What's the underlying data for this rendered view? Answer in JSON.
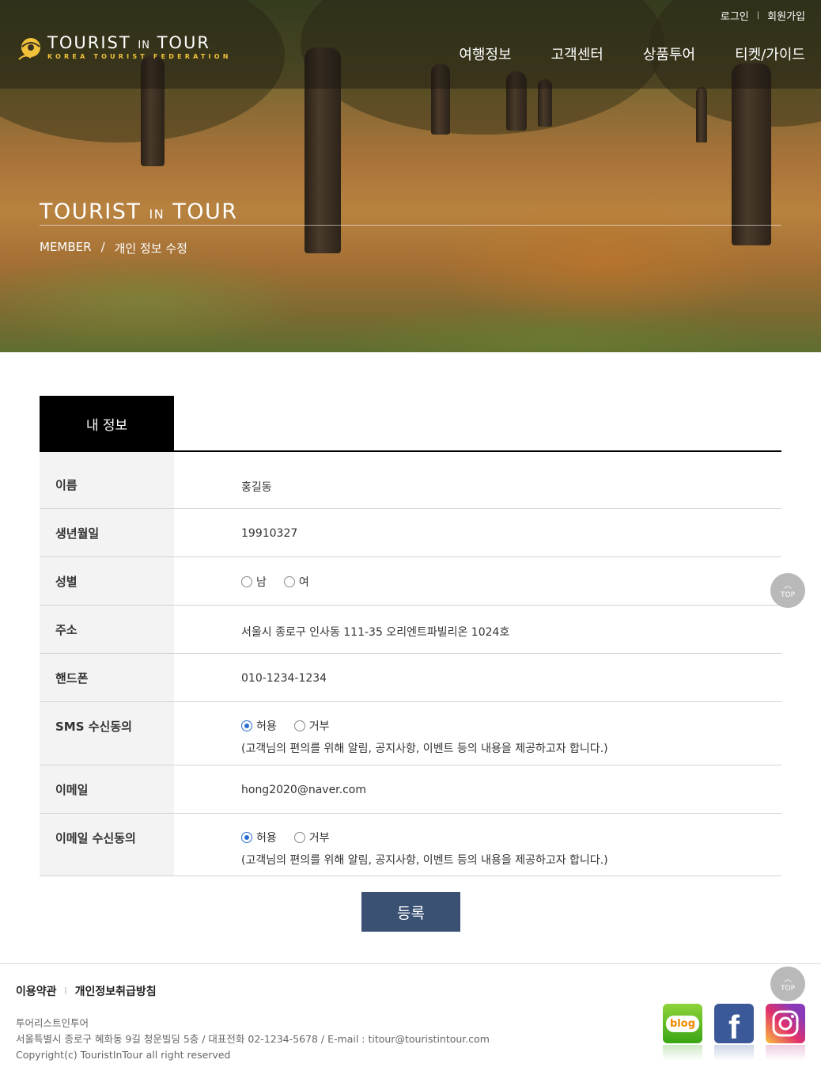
{
  "header": {
    "logo_title": "TOURIST",
    "logo_in": "IN",
    "logo_tour": "TOUR",
    "logo_sub": "KOREA TOURIST FEDERATION",
    "util": {
      "login": "로그인",
      "sep": "|",
      "join": "회원가입"
    },
    "nav": [
      "여행정보",
      "고객센터",
      "상품투어",
      "티켓/가이드"
    ]
  },
  "hero": {
    "title": "TOURIST",
    "title_in": "IN",
    "title_tour": "TOUR",
    "breadcrumb": {
      "root": "MEMBER",
      "sep": "/",
      "current": "개인 정보 수정"
    }
  },
  "tab": {
    "label": "내 정보"
  },
  "form": {
    "name": {
      "label": "이름",
      "value": "홍길동"
    },
    "birth": {
      "label": "생년월일",
      "value": "19910327"
    },
    "gender": {
      "label": "성별",
      "options": [
        "남",
        "여"
      ],
      "selected": null
    },
    "address": {
      "label": "주소",
      "value": "서울시 종로구 인사동 111-35 오리엔트파빌리온 1024호"
    },
    "phone": {
      "label": "핸드폰",
      "value": "010-1234-1234"
    },
    "sms": {
      "label": "SMS 수신동의",
      "options": [
        "허용",
        "거부"
      ],
      "selected": "허용",
      "note": "(고객님의 편의를 위해 알림, 공지사항, 이벤트 등의 내용을 제공하고자 합니다.)"
    },
    "email": {
      "label": "이메일",
      "value": "hong2020@naver.com"
    },
    "email_consent": {
      "label": "이메일 수신동의",
      "options": [
        "허용",
        "거부"
      ],
      "selected": "허용",
      "note": "(고객님의 편의를 위해 알림, 공지사항, 이벤트 등의 내용을 제공하고자 합니다.)"
    },
    "submit_label": "등록"
  },
  "top_button": {
    "label": "TOP"
  },
  "footer": {
    "links": [
      "이용약관",
      "개인정보취급방침"
    ],
    "sep": "|",
    "company": "투어리스트인투어",
    "address": "서울특별시 종로구 혜화동 9길 청운빌딩 5층 / 대표전화 02-1234-5678 / E-mail : titour@touristintour.com",
    "copyright": "Copyright(c) TouristInTour all right reserved",
    "sns": {
      "blog": "blog",
      "facebook": "f"
    }
  },
  "colors": {
    "submit": "#3a5174",
    "tab": "#000000",
    "radio_on": "#2a6fd0",
    "logo_sub": "#f2c23a"
  }
}
